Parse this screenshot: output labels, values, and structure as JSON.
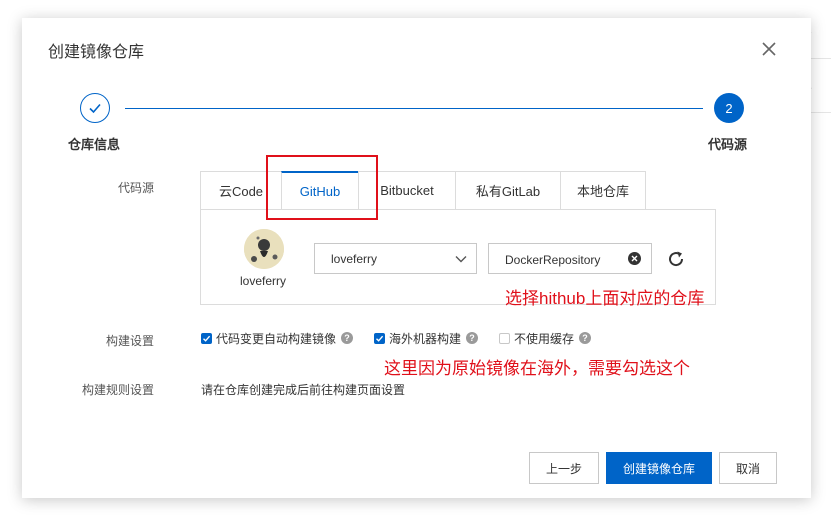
{
  "background": {
    "edge_chars": [
      "2",
      "5"
    ]
  },
  "dialog": {
    "title": "创建镜像仓库",
    "close_icon": "close-icon"
  },
  "steps": [
    {
      "label": "仓库信息",
      "status": "done",
      "icon": "check-icon"
    },
    {
      "label": "代码源",
      "status": "current",
      "number": "2"
    }
  ],
  "source": {
    "label": "代码源",
    "tabs": [
      {
        "label": "云Code",
        "active": false
      },
      {
        "label": "GitHub",
        "active": true
      },
      {
        "label": "Bitbucket",
        "active": false
      },
      {
        "label": "私有GitLab",
        "active": false
      },
      {
        "label": "本地仓库",
        "active": false
      }
    ],
    "account": {
      "name": "loveferry"
    },
    "namespace_select": {
      "value": "loveferry"
    },
    "repo_input": {
      "value": "DockerRepository"
    }
  },
  "build_settings": {
    "label": "构建设置",
    "options": [
      {
        "label": "代码变更自动构建镜像",
        "checked": true
      },
      {
        "label": "海外机器构建",
        "checked": true
      },
      {
        "label": "不使用缓存",
        "checked": false
      }
    ]
  },
  "build_rules": {
    "label": "构建规则设置",
    "text": "请在仓库创建完成后前往构建页面设置"
  },
  "annotations": {
    "select_repo": "选择hithub上面对应的仓库",
    "overseas_note": "这里因为原始镜像在海外，需要勾选这个"
  },
  "footer": {
    "prev": "上一步",
    "create": "创建镜像仓库",
    "cancel": "取消"
  },
  "colors": {
    "primary": "#0064c8",
    "annotation_red": "#e0101a"
  }
}
